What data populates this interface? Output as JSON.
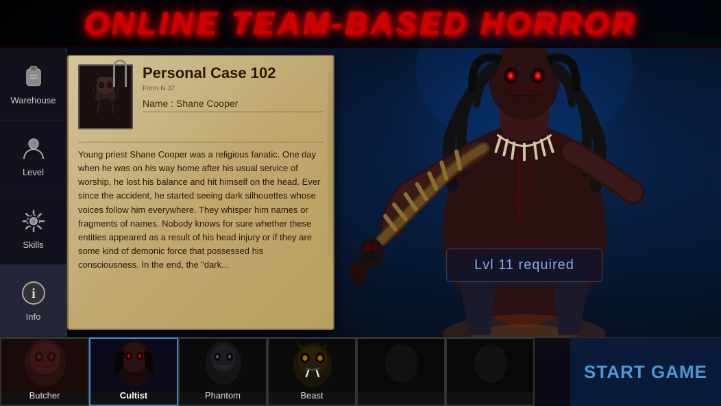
{
  "title": "ONLINE TEAM-BASED HORROR",
  "sidebar": {
    "items": [
      {
        "id": "warehouse",
        "label": "Warehouse",
        "icon": "backpack"
      },
      {
        "id": "level",
        "label": "Level",
        "icon": "person"
      },
      {
        "id": "skills",
        "label": "Skills",
        "icon": "gear"
      },
      {
        "id": "info",
        "label": "Info",
        "icon": "info",
        "active": true
      }
    ]
  },
  "case": {
    "title": "Personal Case 102",
    "form_number": "Form N 37",
    "name_label": "Name : Shane Cooper",
    "body_text": "Young priest Shane Cooper was a religious fanatic. One day when he was on his way home after his usual service of worship, he lost his balance and hit himself on the head. Ever since the accident, he started seeing dark silhouettes whose voices follow him everywhere. They whisper him names or fragments of names. Nobody knows for sure whether these entities appeared as a result of his head injury or if they are some kind of demonic force that possessed his consciousness. In the end, the \"dark..."
  },
  "level_required": "Lvl 11 required",
  "characters": [
    {
      "id": "butcher",
      "label": "Butcher",
      "active": false
    },
    {
      "id": "cultist",
      "label": "Cultist",
      "active": true
    },
    {
      "id": "phantom",
      "label": "Phantom",
      "active": false
    },
    {
      "id": "beast",
      "label": "Beast",
      "active": false
    },
    {
      "id": "slot5",
      "label": "",
      "active": false
    },
    {
      "id": "slot6",
      "label": "",
      "active": false
    }
  ],
  "start_game_button": "START GAME"
}
